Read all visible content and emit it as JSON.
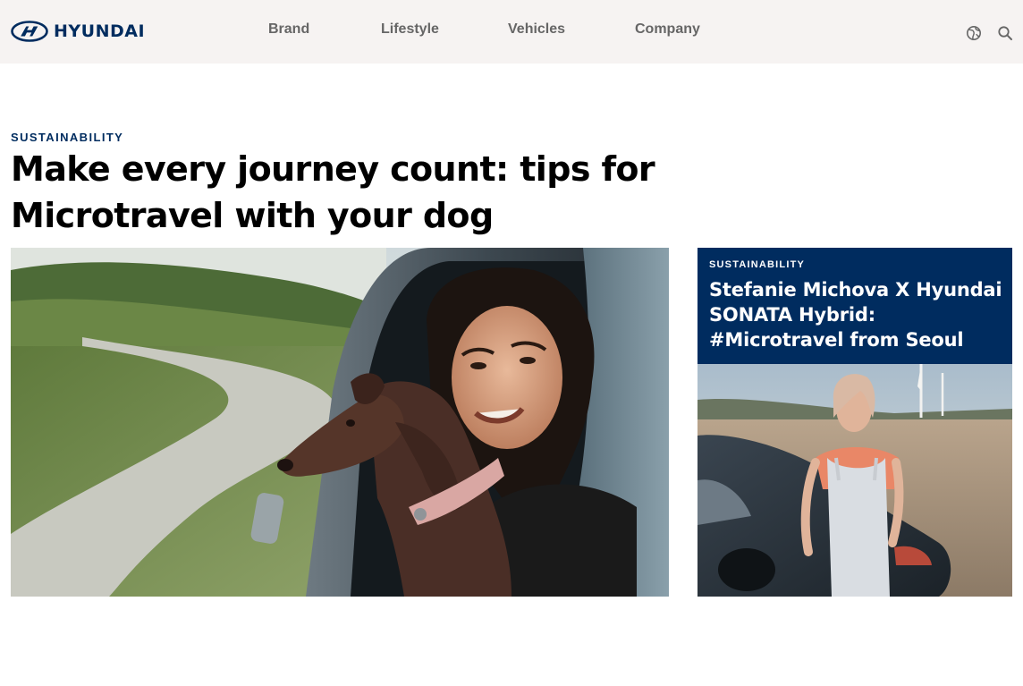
{
  "brand": {
    "logo_text": "HYUNDAI",
    "color": "#002c5f"
  },
  "nav": {
    "items": [
      "Brand",
      "Lifestyle",
      "Vehicles",
      "Company"
    ]
  },
  "header_icons": [
    "globe-icon",
    "search-icon"
  ],
  "article": {
    "category": "SUSTAINABILITY",
    "title": "Make every journey count: tips for Microtravel with your dog"
  },
  "side_card": {
    "category": "SUSTAINABILITY",
    "title": "Stefanie Michova X Hyundai SONATA Hybrid: #Microtravel from Seoul"
  },
  "colors": {
    "header_bg": "#f6f3f2",
    "accent": "#002c5f",
    "nav_text": "#666666"
  }
}
